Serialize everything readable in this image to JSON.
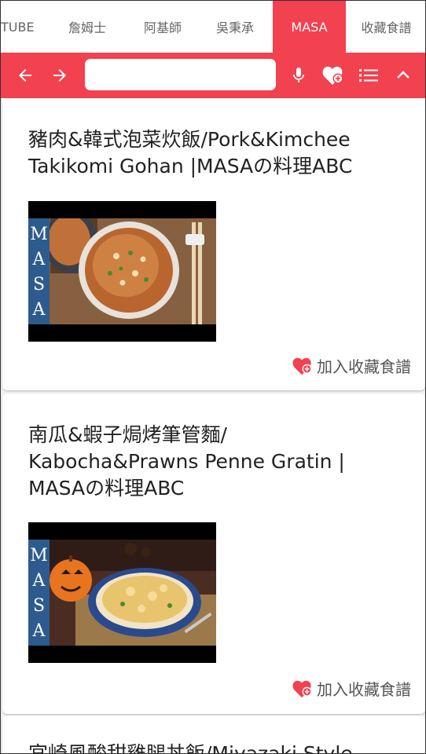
{
  "tabs": [
    {
      "label": "TUBE",
      "active": false
    },
    {
      "label": "詹姆士",
      "active": false
    },
    {
      "label": "阿基師",
      "active": false
    },
    {
      "label": "吳秉承",
      "active": false
    },
    {
      "label": "MASA",
      "active": true
    },
    {
      "label": "收藏食譜",
      "active": false
    }
  ],
  "toolbar": {
    "search_value": "",
    "accent_color": "#f2414f",
    "icons": [
      "arrow-left-icon",
      "arrow-right-icon",
      "microphone-icon",
      "heart-add-icon",
      "list-icon",
      "chevron-up-icon"
    ]
  },
  "cards": [
    {
      "title": "豬肉&韓式泡菜炊飯/Pork&Kimchee Takikomi Gohan |MASAの料理ABC",
      "thumb_label": "MASA",
      "fav_label": "加入收藏食譜"
    },
    {
      "title": "南瓜&蝦子焗烤筆管麵/ Kabocha&Prawns Penne Gratin | MASAの料理ABC",
      "thumb_label": "MASA",
      "fav_label": "加入收藏食譜"
    },
    {
      "title": "宮崎風酸甜雞腿丼飯/Miyazaki Style"
    }
  ]
}
